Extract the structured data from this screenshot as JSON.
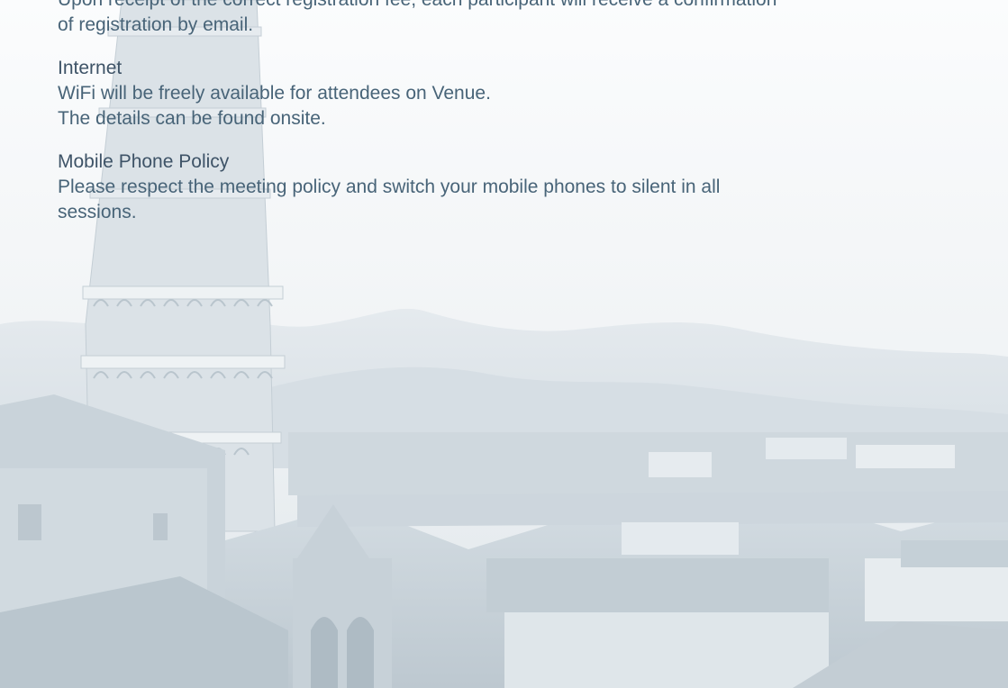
{
  "sections": [
    {
      "heading": "",
      "lines": [
        "Upon receipt of the correct registration fee, each participant will receive a confirmation",
        "of registration by email."
      ]
    },
    {
      "heading": "Internet",
      "lines": [
        "WiFi will be freely available for attendees on Venue.",
        "The details can be found onsite."
      ]
    },
    {
      "heading": "Mobile Phone Policy",
      "lines": [
        "Please respect the meeting policy and switch your mobile phones to silent in all",
        "sessions."
      ]
    }
  ],
  "background": {
    "image": "pisa-leaning-tower-rooftops-mountains",
    "colors": {
      "sky": "#f7f9fa",
      "mountain": "#e3e9ed",
      "tower": "#d8e0e6",
      "rooftop": "#cbd5dc",
      "shadow": "#b7c3cb"
    }
  }
}
